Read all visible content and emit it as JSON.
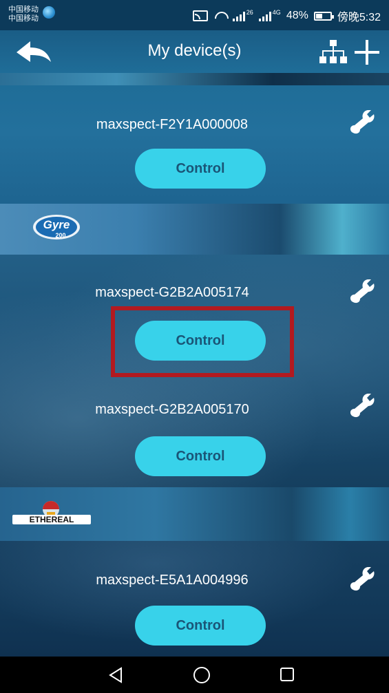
{
  "status_bar": {
    "carrier_line1": "中国移动",
    "carrier_line2": "中国移动",
    "signal1_label": "26",
    "signal2_label": "4G",
    "battery": "48%",
    "battery_level": 0.48,
    "time": "傍晚5:32"
  },
  "header": {
    "title": "My device(s)",
    "back_icon": "back-arrow-icon",
    "network_icon": "network-tree-icon",
    "add_icon": "plus-icon"
  },
  "brands": {
    "gyre_logo_text": "Gyre",
    "gyre_logo_subtext": "200",
    "ethereal_logo_text": "ETHEREAL"
  },
  "devices": [
    {
      "name": "maxspect-F2Y1A000008",
      "control_label": "Control",
      "settings_icon": "wrench-icon"
    },
    {
      "name": "maxspect-G2B2A005174",
      "control_label": "Control",
      "settings_icon": "wrench-icon"
    },
    {
      "name": "maxspect-G2B2A005170",
      "control_label": "Control",
      "settings_icon": "wrench-icon"
    },
    {
      "name": "maxspect-E5A1A004996",
      "control_label": "Control",
      "settings_icon": "wrench-icon"
    }
  ],
  "highlight": {
    "color": "#b21a20"
  },
  "colors": {
    "accent_button": "#38d2ea",
    "button_text": "#1a5577",
    "header_bg": "#1f6d98"
  },
  "nav_bar": {
    "back_icon": "nav-back-icon",
    "home_icon": "nav-home-icon",
    "recent_icon": "nav-recent-icon"
  }
}
